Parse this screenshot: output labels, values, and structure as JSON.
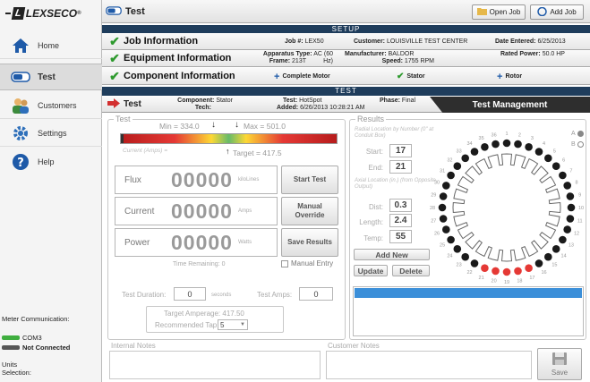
{
  "brand": {
    "name": "LEXSECO",
    "mark": "®"
  },
  "sidebar": {
    "items": [
      {
        "label": "Home",
        "icon": "home-icon"
      },
      {
        "label": "Test",
        "icon": "test-icon"
      },
      {
        "label": "Customers",
        "icon": "customers-icon"
      },
      {
        "label": "Settings",
        "icon": "gear-icon"
      },
      {
        "label": "Help",
        "icon": "help-icon"
      }
    ],
    "meter_label": "Meter Communication:",
    "port_label": "COM3",
    "status_label": "Not Connected",
    "units_label": "Units Selection:"
  },
  "topbar": {
    "title": "Test",
    "open_job": "Open Job",
    "add_job": "Add Job"
  },
  "setup": {
    "header": "SETUP",
    "job": {
      "title": "Job Information",
      "job_no_k": "Job #:",
      "job_no_v": "LEX50",
      "customer_k": "Customer:",
      "customer_v": "LOUISVILLE TEST CENTER",
      "date_k": "Date Entered:",
      "date_v": "6/25/2013"
    },
    "equipment": {
      "title": "Equipment Information",
      "app_k": "Apparatus Type:",
      "app_v": "AC (60 Hz)",
      "frame_k": "Frame:",
      "frame_v": "213T",
      "mfr_k": "Manufacturer:",
      "mfr_v": "BALDOR",
      "speed_k": "Speed:",
      "speed_v": "1755 RPM",
      "power_k": "Rated Power:",
      "power_v": "50.0 HP"
    },
    "component": {
      "title": "Component Information",
      "motor": "Complete Motor",
      "stator": "Stator",
      "rotor": "Rotor"
    }
  },
  "test": {
    "header": "TEST",
    "label": "Test",
    "component_k": "Component:",
    "component_v": "Stator",
    "tech_k": "Tech:",
    "tech_v": "",
    "test_k": "Test:",
    "test_v": "HotSpot",
    "added_k": "Added:",
    "added_v": "6/26/2013 10:28:21 AM",
    "phase_k": "Phase:",
    "phase_v": "Final",
    "mgmt_tab": "Test Management"
  },
  "testpanel": {
    "title": "Test",
    "min": "Min = 334.0",
    "max": "Max = 501.0",
    "target": "Target = 417.5",
    "current_note": "Current (Amps) =",
    "flux": {
      "label": "Flux",
      "value": "00000",
      "unit": "kiloLines"
    },
    "current": {
      "label": "Current",
      "value": "00000",
      "unit": "Amps"
    },
    "power": {
      "label": "Power",
      "value": "00000",
      "unit": "Watts"
    },
    "start_btn": "Start Test",
    "manual_btn": "Manual Override",
    "save_btn": "Save Results",
    "time_remaining": "Time Remaining: 0",
    "manual_entry": "Manual Entry",
    "duration_label": "Test Duration:",
    "duration_value": "0",
    "duration_unit": "seconds",
    "amps_label": "Test Amps:",
    "amps_value": "0",
    "target_amperage": "Target Amperage: 417.50",
    "recommended_tap": "Recommended Tap:",
    "tap_value": "5",
    "gauge": {
      "green_center": 0.5,
      "colors": [
        "#c62828",
        "#e53935",
        "#fdd835",
        "#66bb6a",
        "#fdd835",
        "#e53935",
        "#c62828"
      ]
    }
  },
  "results": {
    "title": "Results",
    "radial_note": "Radial Location by Number (0\" at Conduit Box)",
    "start_label": "Start:",
    "start_value": "17",
    "end_label": "End:",
    "end_value": "21",
    "axial_note": "Axial Location (in.) (from Opposite Output)",
    "dist_label": "Dist:",
    "dist_value": "0.3",
    "length_label": "Length:",
    "length_value": "2.4",
    "temp_label": "Temp:",
    "temp_value": "55",
    "add_new": "Add New",
    "update": "Update",
    "delete": "Delete",
    "option_a": "A",
    "option_b": "B",
    "slot_count": 36,
    "highlight": [
      17,
      18,
      19,
      20,
      21
    ]
  },
  "notes": {
    "internal": "Internal Notes",
    "customer": "Customer Notes",
    "save": "Save"
  }
}
